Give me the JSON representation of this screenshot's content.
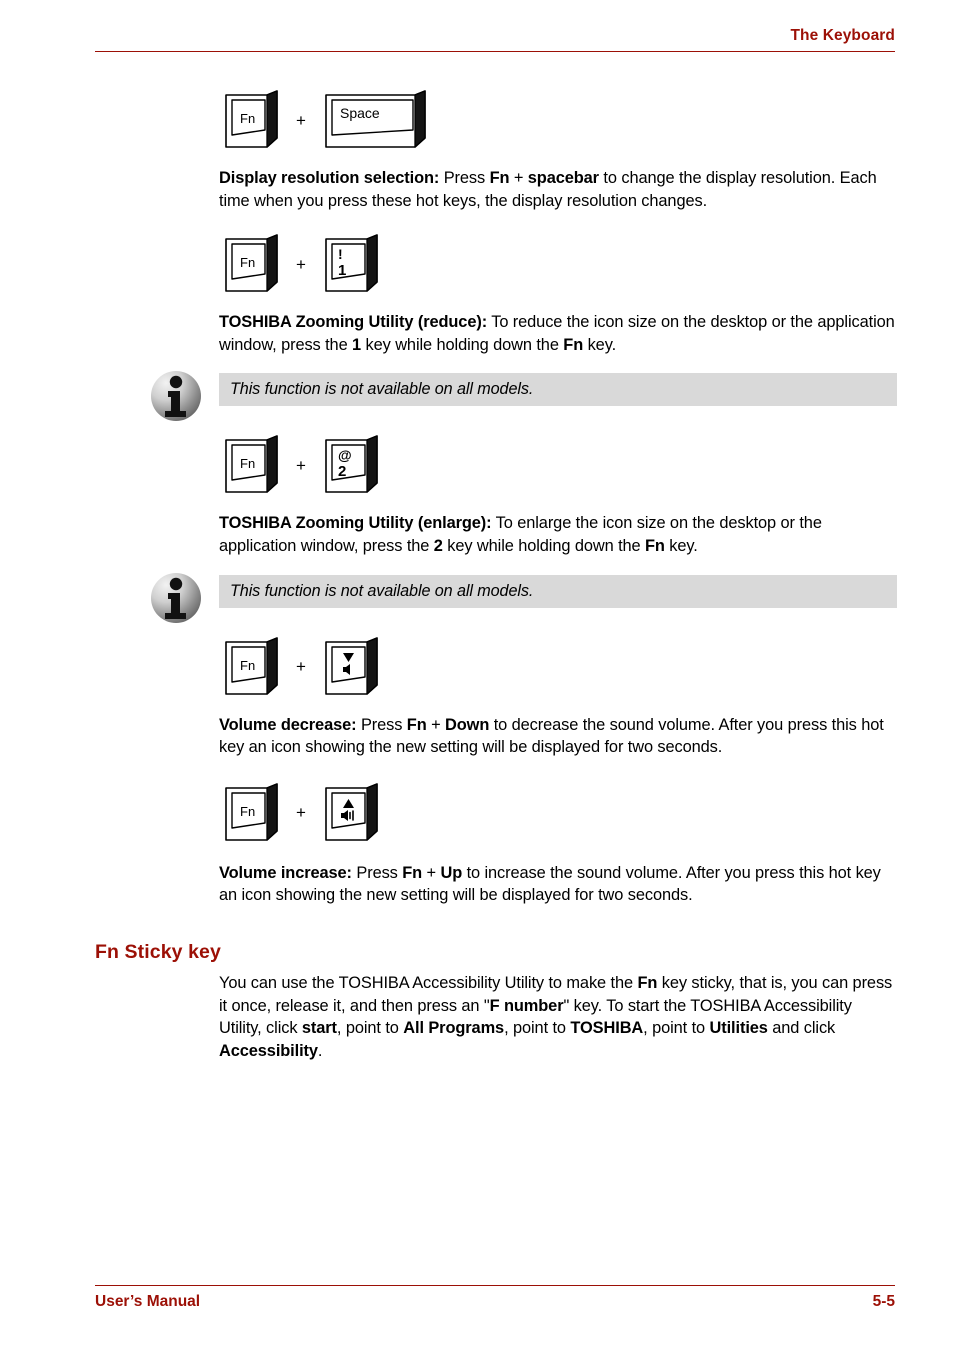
{
  "header": {
    "title": "The Keyboard"
  },
  "accent_color": "#9c1006",
  "note_bg_color": "#d9d9d9",
  "plus": "+",
  "keys": {
    "fn": "Fn",
    "space": "Space",
    "one_upper": "!",
    "one_lower": "1",
    "two_upper": "@",
    "two_lower": "2"
  },
  "sections": [
    {
      "id": "display-resolution",
      "key_combo": [
        "Fn",
        "Space"
      ],
      "paragraph_parts": [
        {
          "text": "Display resolution selection:",
          "bold": true
        },
        {
          "text": " Press ",
          "bold": false
        },
        {
          "text": "Fn",
          "bold": true
        },
        {
          "text": " + ",
          "bold": false
        },
        {
          "text": "spacebar",
          "bold": true
        },
        {
          "text": " to change the display resolution. Each time when you press these hot keys, the display resolution changes.",
          "bold": false
        }
      ]
    },
    {
      "id": "zooming-reduce",
      "key_combo": [
        "Fn",
        "1"
      ],
      "paragraph_parts": [
        {
          "text": "TOSHIBA Zooming Utility (reduce):",
          "bold": true
        },
        {
          "text": " To reduce the icon size on the desktop or the application window, press the ",
          "bold": false
        },
        {
          "text": "1",
          "bold": true
        },
        {
          "text": " key while holding down the ",
          "bold": false
        },
        {
          "text": "Fn",
          "bold": true
        },
        {
          "text": " key.",
          "bold": false
        }
      ],
      "note": "This function is not available on all models."
    },
    {
      "id": "zooming-enlarge",
      "key_combo": [
        "Fn",
        "2"
      ],
      "paragraph_parts": [
        {
          "text": "TOSHIBA Zooming Utility (enlarge):",
          "bold": true
        },
        {
          "text": " To enlarge the icon size on the desktop or the application window, press the ",
          "bold": false
        },
        {
          "text": "2",
          "bold": true
        },
        {
          "text": " key while holding down the ",
          "bold": false
        },
        {
          "text": "Fn",
          "bold": true
        },
        {
          "text": " key.",
          "bold": false
        }
      ],
      "note": "This function is not available on all models."
    },
    {
      "id": "volume-decrease",
      "key_combo": [
        "Fn",
        "VolumeDown"
      ],
      "paragraph_parts": [
        {
          "text": "Volume decrease:",
          "bold": true
        },
        {
          "text": " Press ",
          "bold": false
        },
        {
          "text": "Fn",
          "bold": true
        },
        {
          "text": " + ",
          "bold": false
        },
        {
          "text": "Down",
          "bold": true
        },
        {
          "text": " to decrease the sound volume. After you press this hot key an icon showing the new setting will be displayed for two seconds.",
          "bold": false
        }
      ]
    },
    {
      "id": "volume-increase",
      "key_combo": [
        "Fn",
        "VolumeUp"
      ],
      "paragraph_parts": [
        {
          "text": "Volume increase:",
          "bold": true
        },
        {
          "text": " Press ",
          "bold": false
        },
        {
          "text": "Fn",
          "bold": true
        },
        {
          "text": " + ",
          "bold": false
        },
        {
          "text": "Up",
          "bold": true
        },
        {
          "text": " to increase the sound volume. After you press this hot key an icon showing the new setting will be displayed for two seconds.",
          "bold": false
        }
      ]
    }
  ],
  "fn_sticky": {
    "heading": "Fn Sticky key",
    "paragraph_parts": [
      {
        "text": "You can use the TOSHIBA Accessibility Utility to make the ",
        "bold": false
      },
      {
        "text": "Fn",
        "bold": true
      },
      {
        "text": " key sticky, that is, you can press it once, release it, and then press an \"",
        "bold": false
      },
      {
        "text": "F number",
        "bold": true
      },
      {
        "text": "\" key. To start the TOSHIBA Accessibility Utility, click ",
        "bold": false
      },
      {
        "text": "start",
        "bold": true
      },
      {
        "text": ", point to ",
        "bold": false
      },
      {
        "text": "All Programs",
        "bold": true
      },
      {
        "text": ", point to ",
        "bold": false
      },
      {
        "text": "TOSHIBA",
        "bold": true
      },
      {
        "text": ", point to ",
        "bold": false
      },
      {
        "text": "Utilities",
        "bold": true
      },
      {
        "text": " and click ",
        "bold": false
      },
      {
        "text": "Accessibility",
        "bold": true
      },
      {
        "text": ".",
        "bold": false
      }
    ]
  },
  "footer": {
    "left": "User’s Manual",
    "right": "5-5"
  }
}
